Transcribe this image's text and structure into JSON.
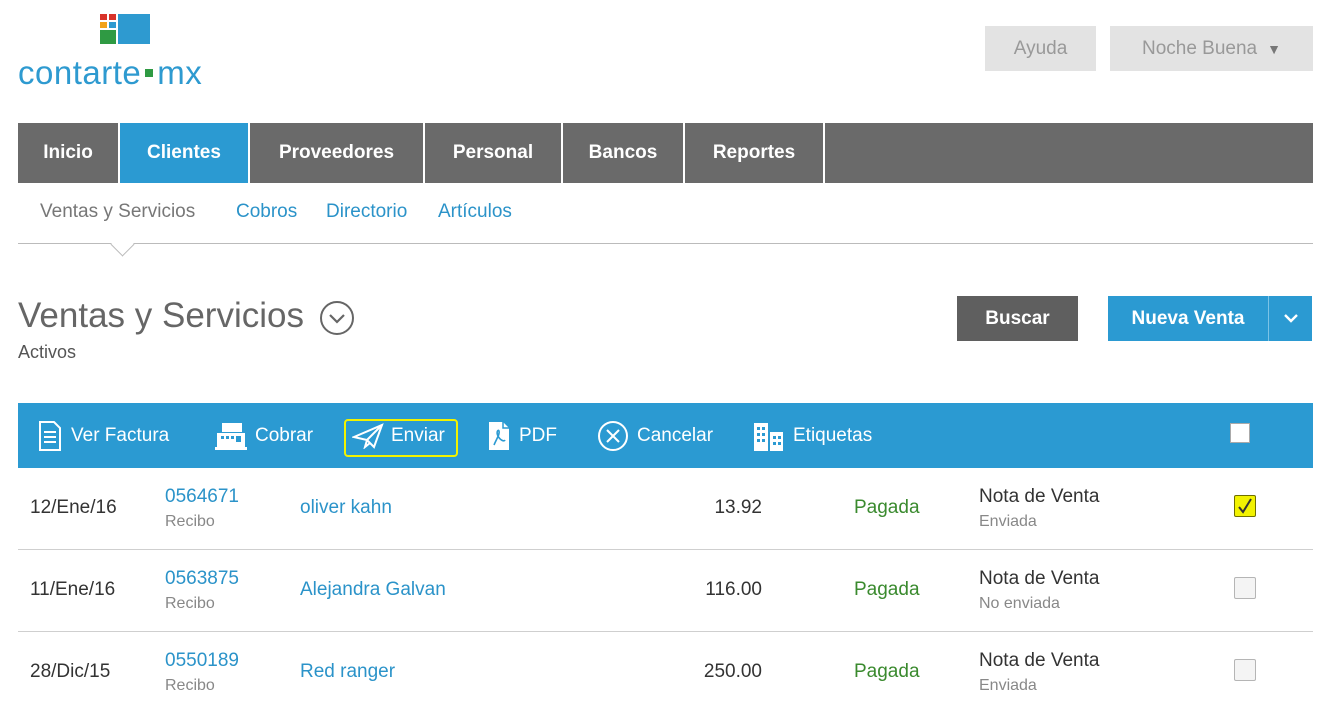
{
  "logo": {
    "brand": "contarte",
    "suffix": "mx"
  },
  "header": {
    "help_label": "Ayuda",
    "user_label": "Noche Buena"
  },
  "nav": [
    {
      "label": "Inicio",
      "active": false
    },
    {
      "label": "Clientes",
      "active": true
    },
    {
      "label": "Proveedores",
      "active": false
    },
    {
      "label": "Personal",
      "active": false
    },
    {
      "label": "Bancos",
      "active": false
    },
    {
      "label": "Reportes",
      "active": false
    }
  ],
  "subnav": [
    {
      "label": "Ventas y Servicios",
      "current": true
    },
    {
      "label": "Cobros",
      "current": false
    },
    {
      "label": "Directorio",
      "current": false
    },
    {
      "label": "Artículos",
      "current": false
    }
  ],
  "page": {
    "title": "Ventas y Servicios",
    "subtitle": "Activos",
    "search_label": "Buscar",
    "new_sale_label": "Nueva Venta"
  },
  "toolbar": [
    {
      "label": "Ver Factura",
      "icon": "invoice-icon"
    },
    {
      "label": "Cobrar",
      "icon": "cash-register-icon"
    },
    {
      "label": "Enviar",
      "icon": "paper-plane-icon",
      "highlighted": true
    },
    {
      "label": "PDF",
      "icon": "pdf-icon"
    },
    {
      "label": "Cancelar",
      "icon": "cancel-icon"
    },
    {
      "label": "Etiquetas",
      "icon": "buildings-icon"
    }
  ],
  "rows": [
    {
      "date": "12/Ene/16",
      "number": "0564671",
      "type": "Recibo",
      "client": "oliver kahn",
      "amount": "13.92",
      "status": "Pagada",
      "doc": "Nota de Venta",
      "sent": "Enviada",
      "checked": true
    },
    {
      "date": "11/Ene/16",
      "number": "0563875",
      "type": "Recibo",
      "client": "Alejandra Galvan",
      "amount": "116.00",
      "status": "Pagada",
      "doc": "Nota de Venta",
      "sent": "No enviada",
      "checked": false
    },
    {
      "date": "28/Dic/15",
      "number": "0550189",
      "type": "Recibo",
      "client": "Red ranger",
      "amount": "250.00",
      "status": "Pagada",
      "doc": "Nota de Venta",
      "sent": "Enviada",
      "checked": false
    }
  ],
  "colors": {
    "accent": "#2b9ad2",
    "nav_bg": "#6a6a6a",
    "paid": "#3a8a2e",
    "highlight": "#f2f200"
  }
}
